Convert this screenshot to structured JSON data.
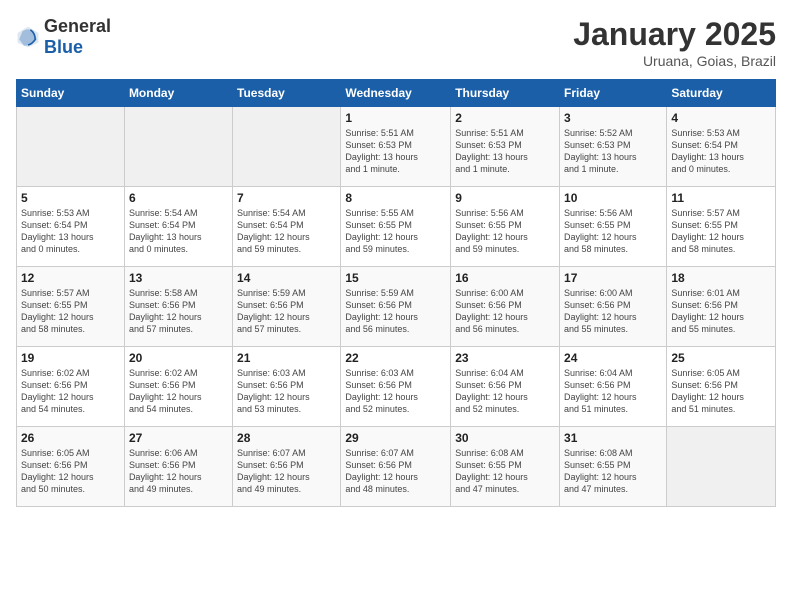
{
  "logo": {
    "general": "General",
    "blue": "Blue"
  },
  "header": {
    "month": "January 2025",
    "location": "Uruana, Goias, Brazil"
  },
  "weekdays": [
    "Sunday",
    "Monday",
    "Tuesday",
    "Wednesday",
    "Thursday",
    "Friday",
    "Saturday"
  ],
  "weeks": [
    [
      {
        "day": "",
        "info": ""
      },
      {
        "day": "",
        "info": ""
      },
      {
        "day": "",
        "info": ""
      },
      {
        "day": "1",
        "info": "Sunrise: 5:51 AM\nSunset: 6:53 PM\nDaylight: 13 hours\nand 1 minute."
      },
      {
        "day": "2",
        "info": "Sunrise: 5:51 AM\nSunset: 6:53 PM\nDaylight: 13 hours\nand 1 minute."
      },
      {
        "day": "3",
        "info": "Sunrise: 5:52 AM\nSunset: 6:53 PM\nDaylight: 13 hours\nand 1 minute."
      },
      {
        "day": "4",
        "info": "Sunrise: 5:53 AM\nSunset: 6:54 PM\nDaylight: 13 hours\nand 0 minutes."
      }
    ],
    [
      {
        "day": "5",
        "info": "Sunrise: 5:53 AM\nSunset: 6:54 PM\nDaylight: 13 hours\nand 0 minutes."
      },
      {
        "day": "6",
        "info": "Sunrise: 5:54 AM\nSunset: 6:54 PM\nDaylight: 13 hours\nand 0 minutes."
      },
      {
        "day": "7",
        "info": "Sunrise: 5:54 AM\nSunset: 6:54 PM\nDaylight: 12 hours\nand 59 minutes."
      },
      {
        "day": "8",
        "info": "Sunrise: 5:55 AM\nSunset: 6:55 PM\nDaylight: 12 hours\nand 59 minutes."
      },
      {
        "day": "9",
        "info": "Sunrise: 5:56 AM\nSunset: 6:55 PM\nDaylight: 12 hours\nand 59 minutes."
      },
      {
        "day": "10",
        "info": "Sunrise: 5:56 AM\nSunset: 6:55 PM\nDaylight: 12 hours\nand 58 minutes."
      },
      {
        "day": "11",
        "info": "Sunrise: 5:57 AM\nSunset: 6:55 PM\nDaylight: 12 hours\nand 58 minutes."
      }
    ],
    [
      {
        "day": "12",
        "info": "Sunrise: 5:57 AM\nSunset: 6:55 PM\nDaylight: 12 hours\nand 58 minutes."
      },
      {
        "day": "13",
        "info": "Sunrise: 5:58 AM\nSunset: 6:56 PM\nDaylight: 12 hours\nand 57 minutes."
      },
      {
        "day": "14",
        "info": "Sunrise: 5:59 AM\nSunset: 6:56 PM\nDaylight: 12 hours\nand 57 minutes."
      },
      {
        "day": "15",
        "info": "Sunrise: 5:59 AM\nSunset: 6:56 PM\nDaylight: 12 hours\nand 56 minutes."
      },
      {
        "day": "16",
        "info": "Sunrise: 6:00 AM\nSunset: 6:56 PM\nDaylight: 12 hours\nand 56 minutes."
      },
      {
        "day": "17",
        "info": "Sunrise: 6:00 AM\nSunset: 6:56 PM\nDaylight: 12 hours\nand 55 minutes."
      },
      {
        "day": "18",
        "info": "Sunrise: 6:01 AM\nSunset: 6:56 PM\nDaylight: 12 hours\nand 55 minutes."
      }
    ],
    [
      {
        "day": "19",
        "info": "Sunrise: 6:02 AM\nSunset: 6:56 PM\nDaylight: 12 hours\nand 54 minutes."
      },
      {
        "day": "20",
        "info": "Sunrise: 6:02 AM\nSunset: 6:56 PM\nDaylight: 12 hours\nand 54 minutes."
      },
      {
        "day": "21",
        "info": "Sunrise: 6:03 AM\nSunset: 6:56 PM\nDaylight: 12 hours\nand 53 minutes."
      },
      {
        "day": "22",
        "info": "Sunrise: 6:03 AM\nSunset: 6:56 PM\nDaylight: 12 hours\nand 52 minutes."
      },
      {
        "day": "23",
        "info": "Sunrise: 6:04 AM\nSunset: 6:56 PM\nDaylight: 12 hours\nand 52 minutes."
      },
      {
        "day": "24",
        "info": "Sunrise: 6:04 AM\nSunset: 6:56 PM\nDaylight: 12 hours\nand 51 minutes."
      },
      {
        "day": "25",
        "info": "Sunrise: 6:05 AM\nSunset: 6:56 PM\nDaylight: 12 hours\nand 51 minutes."
      }
    ],
    [
      {
        "day": "26",
        "info": "Sunrise: 6:05 AM\nSunset: 6:56 PM\nDaylight: 12 hours\nand 50 minutes."
      },
      {
        "day": "27",
        "info": "Sunrise: 6:06 AM\nSunset: 6:56 PM\nDaylight: 12 hours\nand 49 minutes."
      },
      {
        "day": "28",
        "info": "Sunrise: 6:07 AM\nSunset: 6:56 PM\nDaylight: 12 hours\nand 49 minutes."
      },
      {
        "day": "29",
        "info": "Sunrise: 6:07 AM\nSunset: 6:56 PM\nDaylight: 12 hours\nand 48 minutes."
      },
      {
        "day": "30",
        "info": "Sunrise: 6:08 AM\nSunset: 6:55 PM\nDaylight: 12 hours\nand 47 minutes."
      },
      {
        "day": "31",
        "info": "Sunrise: 6:08 AM\nSunset: 6:55 PM\nDaylight: 12 hours\nand 47 minutes."
      },
      {
        "day": "",
        "info": ""
      }
    ]
  ]
}
